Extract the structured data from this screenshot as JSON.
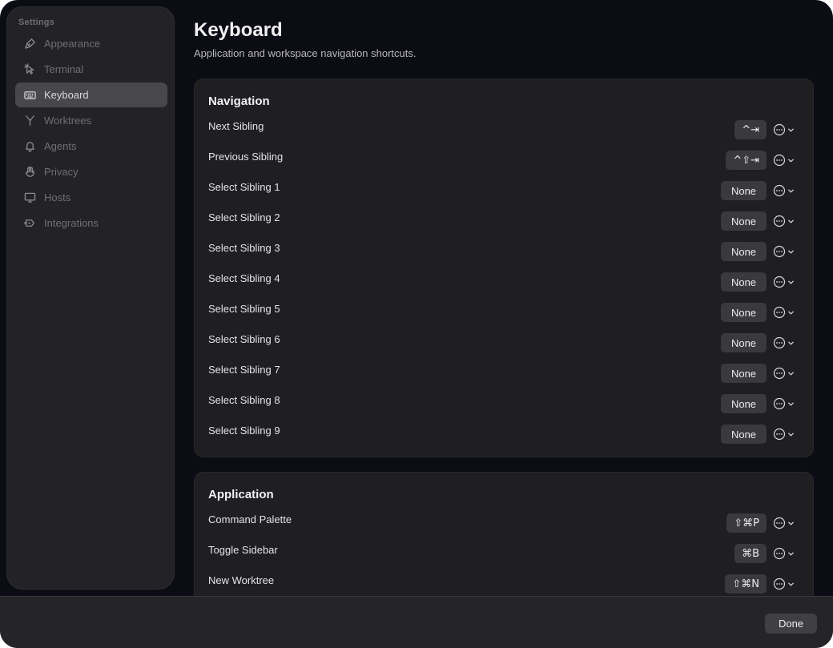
{
  "sidebar": {
    "title": "Settings",
    "items": [
      {
        "label": "Appearance",
        "icon": "brush-icon"
      },
      {
        "label": "Terminal",
        "icon": "cursor-icon"
      },
      {
        "label": "Keyboard",
        "icon": "keyboard-icon",
        "active": true
      },
      {
        "label": "Worktrees",
        "icon": "branch-icon"
      },
      {
        "label": "Agents",
        "icon": "bell-icon"
      },
      {
        "label": "Privacy",
        "icon": "hand-icon"
      },
      {
        "label": "Hosts",
        "icon": "monitor-icon"
      },
      {
        "label": "Integrations",
        "icon": "plug-icon"
      }
    ]
  },
  "main": {
    "title": "Keyboard",
    "subtitle": "Application and workspace navigation shortcuts."
  },
  "sections": {
    "navigation": {
      "title": "Navigation",
      "rows": [
        {
          "label": "Next Sibling",
          "shortcut": "^⇥"
        },
        {
          "label": "Previous Sibling",
          "shortcut": "^⇧⇥"
        },
        {
          "label": "Select Sibling 1",
          "shortcut": "None"
        },
        {
          "label": "Select Sibling 2",
          "shortcut": "None"
        },
        {
          "label": "Select Sibling 3",
          "shortcut": "None"
        },
        {
          "label": "Select Sibling 4",
          "shortcut": "None"
        },
        {
          "label": "Select Sibling 5",
          "shortcut": "None"
        },
        {
          "label": "Select Sibling 6",
          "shortcut": "None"
        },
        {
          "label": "Select Sibling 7",
          "shortcut": "None"
        },
        {
          "label": "Select Sibling 8",
          "shortcut": "None"
        },
        {
          "label": "Select Sibling 9",
          "shortcut": "None"
        }
      ]
    },
    "application": {
      "title": "Application",
      "rows": [
        {
          "label": "Command Palette",
          "shortcut": "⇧⌘P"
        },
        {
          "label": "Toggle Sidebar",
          "shortcut": "⌘B"
        },
        {
          "label": "New Worktree",
          "shortcut": "⇧⌘N"
        }
      ]
    }
  },
  "footer": {
    "done_label": "Done"
  },
  "colors": {
    "window_bg": "#0c0d14",
    "sidebar_bg": "#232327",
    "active_item_bg": "#48484c",
    "section_bg": "#1f1f21",
    "chip_bg": "#3a3a3d"
  }
}
